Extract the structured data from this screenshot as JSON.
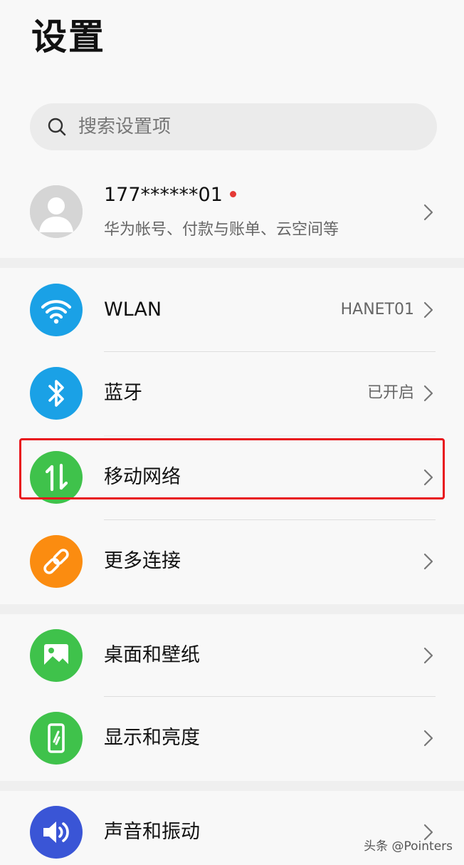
{
  "header": {
    "title": "设置"
  },
  "search": {
    "placeholder": "搜索设置项",
    "icon": "search-icon"
  },
  "account": {
    "name": "177******01",
    "subtitle": "华为帐号、付款与账单、云空间等",
    "has_notification_dot": true,
    "notification_color": "#e53935"
  },
  "groups": [
    {
      "items": [
        {
          "id": "wlan",
          "label": "WLAN",
          "value": "HANET01",
          "icon": "wifi-icon",
          "icon_color": "#1aa1e6"
        },
        {
          "id": "bluetooth",
          "label": "蓝牙",
          "value": "已开启",
          "icon": "bluetooth-icon",
          "icon_color": "#1aa1e6"
        },
        {
          "id": "mobile-network",
          "label": "移动网络",
          "value": "",
          "icon": "mobile-data-icon",
          "icon_color": "#3fc24b",
          "highlighted": true
        },
        {
          "id": "more-connections",
          "label": "更多连接",
          "value": "",
          "icon": "link-icon",
          "icon_color": "#fb8c10"
        }
      ]
    },
    {
      "items": [
        {
          "id": "wallpaper",
          "label": "桌面和壁纸",
          "value": "",
          "icon": "picture-icon",
          "icon_color": "#3fc24b"
        },
        {
          "id": "display",
          "label": "显示和亮度",
          "value": "",
          "icon": "display-phone-icon",
          "icon_color": "#3fc24b"
        }
      ]
    },
    {
      "items": [
        {
          "id": "sound",
          "label": "声音和振动",
          "value": "",
          "icon": "speaker-icon",
          "icon_color": "#3a55d6"
        }
      ]
    }
  ],
  "highlight_color": "#e8141c",
  "watermark": "头条 @Pointers"
}
